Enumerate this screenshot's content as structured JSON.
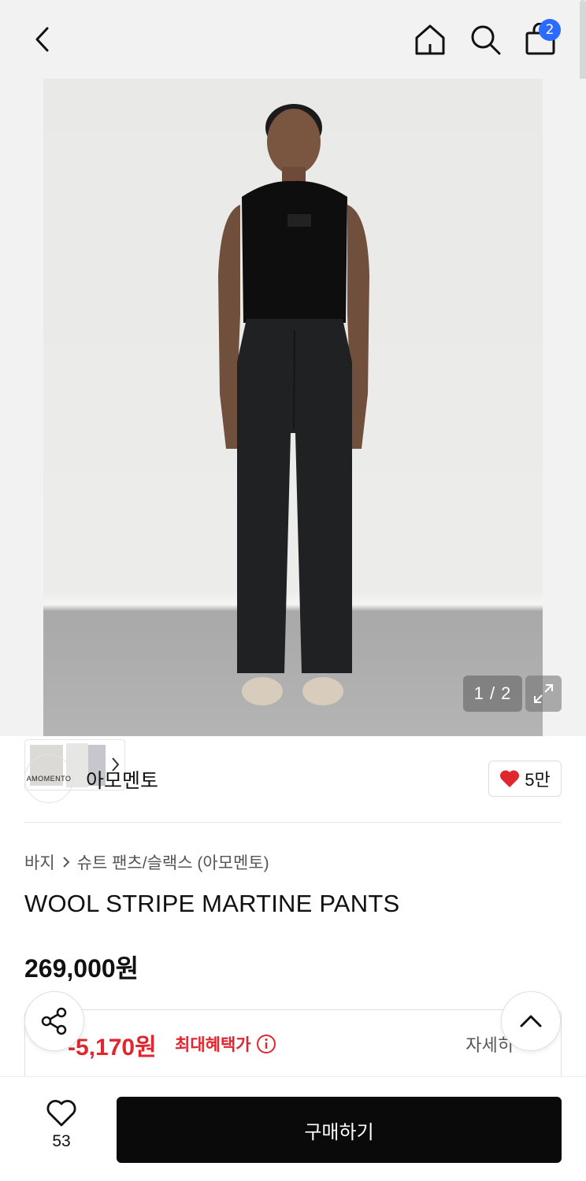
{
  "header": {
    "back_icon": "chevron-left-icon",
    "home_icon": "home-icon",
    "search_icon": "search-icon",
    "cart_icon": "shopping-bag-icon",
    "cart_count": "2",
    "badge_color": "#2b6bff"
  },
  "gallery": {
    "counter": "1 / 2",
    "expand_icon": "expand-icon"
  },
  "brand": {
    "logo_text": "AMOMENTO",
    "name": "아모멘토",
    "likes": "5만",
    "like_color": "#e0272f"
  },
  "breadcrumb": {
    "category": "바지",
    "subcategory": "슈트 팬츠/슬랙스 (아모멘토)"
  },
  "product": {
    "title": "WOOL STRIPE MARTINE PANTS",
    "price": "269,000원"
  },
  "benefit": {
    "price": "-5,170원",
    "label": "최대혜택가",
    "detail": "자세히",
    "accent_color": "#e0272f"
  },
  "bottom_bar": {
    "wish_count": "53",
    "buy_label": "구매하기"
  }
}
